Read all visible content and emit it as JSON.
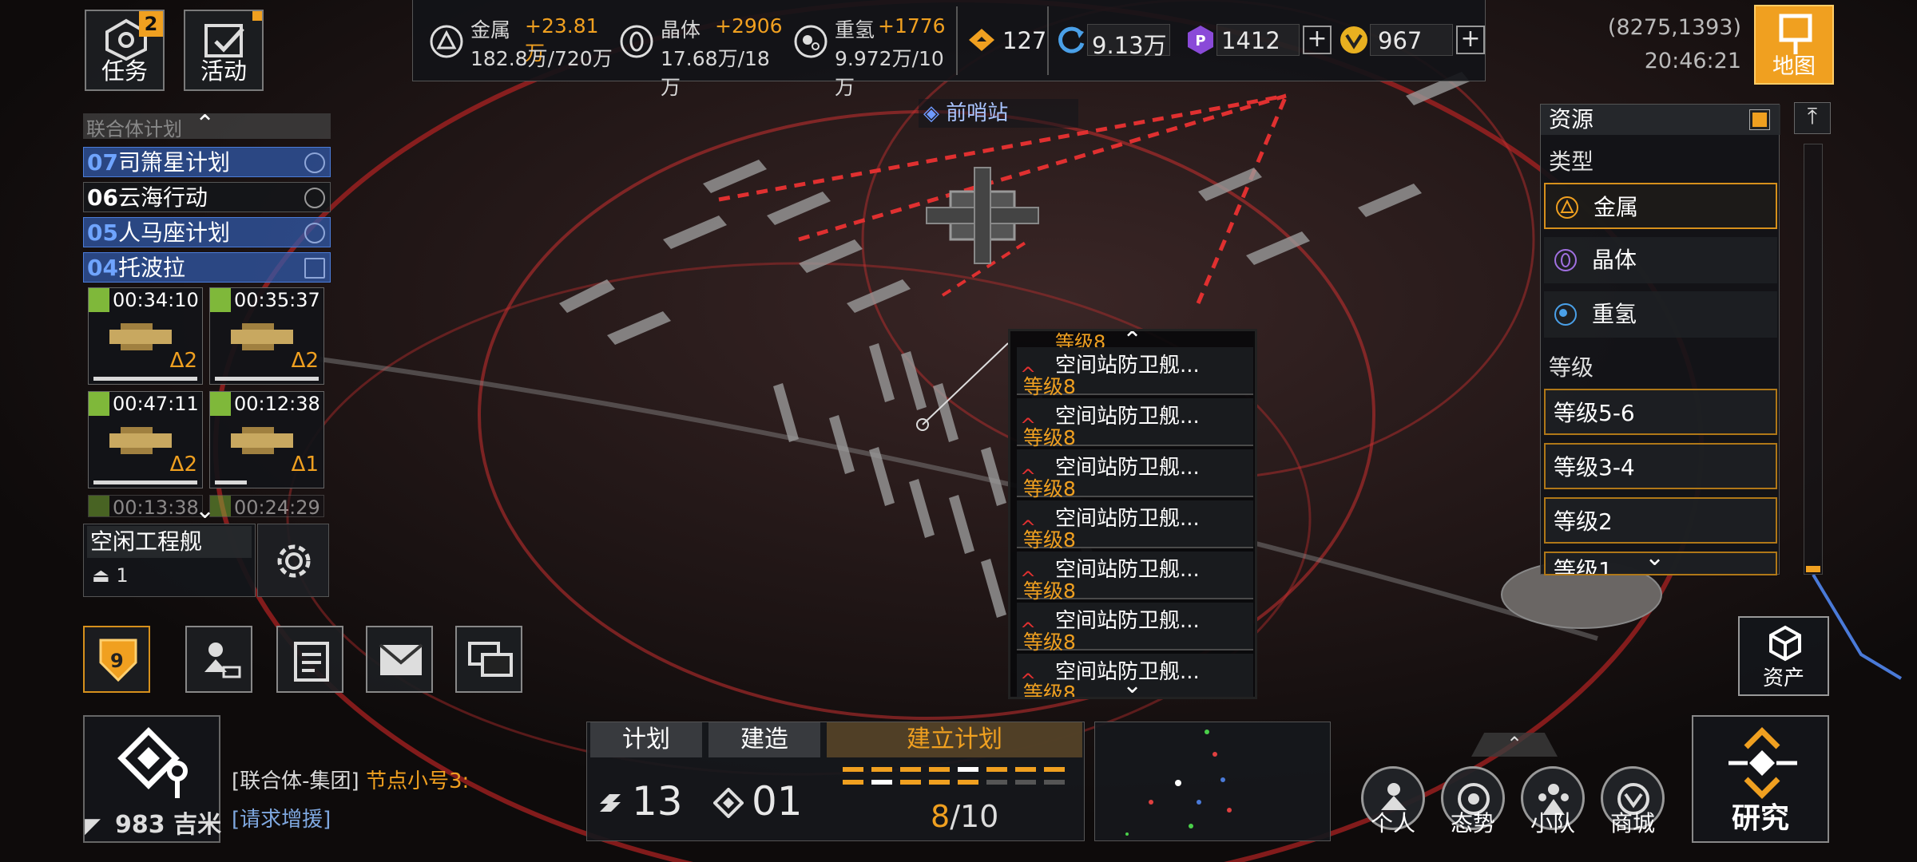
{
  "top_buttons": {
    "tasks": {
      "label": "任务",
      "badge": "2"
    },
    "activity": {
      "label": "活动"
    }
  },
  "resources": {
    "metal": {
      "name": "金属",
      "gain": "+23.81万",
      "amount": "182.8万/720万"
    },
    "crystal": {
      "name": "晶体",
      "gain": "+2906",
      "amount": "17.68万/18万"
    },
    "deuterium": {
      "name": "重氢",
      "gain": "+1776",
      "amount": "9.972万/10万"
    }
  },
  "currencies": {
    "command": "127",
    "cycle": "9.13万",
    "purple": "1412",
    "gold": "967",
    "plus": "+"
  },
  "coords": {
    "position": "(8275,1393)",
    "time": "20:46:21"
  },
  "map_button": {
    "label": "地图"
  },
  "outpost_label": "前哨站",
  "missions": {
    "header": "联合体计划",
    "items": [
      {
        "num": "07",
        "name": "司箫星计划"
      },
      {
        "num": "06",
        "name": "云海行动"
      },
      {
        "num": "05",
        "name": "人马座计划"
      },
      {
        "num": "04",
        "name": "托波拉"
      }
    ]
  },
  "timers": [
    {
      "time": "00:34:10",
      "level": "Δ2"
    },
    {
      "time": "00:35:37",
      "level": "Δ2"
    },
    {
      "time": "00:47:11",
      "level": "Δ2"
    },
    {
      "time": "00:12:38",
      "level": "Δ1"
    },
    {
      "time": "00:13:38",
      "level": ""
    },
    {
      "time": "00:24:29",
      "level": ""
    }
  ],
  "idle": {
    "title": "空闲工程舰",
    "count": "1"
  },
  "level_badge": "9",
  "filter": {
    "header": "资源",
    "type_label": "类型",
    "types": [
      "金属",
      "晶体",
      "重氢"
    ],
    "level_label": "等级",
    "levels": [
      "等级5-6",
      "等级3-4",
      "等级2",
      "等级1"
    ]
  },
  "list": {
    "top_partial": "等级8",
    "rows": [
      {
        "name": "空间站防卫舰...",
        "level": "等级8"
      },
      {
        "name": "空间站防卫舰...",
        "level": "等级8"
      },
      {
        "name": "空间站防卫舰...",
        "level": "等级8"
      },
      {
        "name": "空间站防卫舰...",
        "level": "等级8"
      },
      {
        "name": "空间站防卫舰...",
        "level": "等级8"
      },
      {
        "name": "空间站防卫舰...",
        "level": "等级8"
      },
      {
        "name": "空间站防卫舰...",
        "level": "等级8"
      }
    ]
  },
  "bottom": {
    "distance": "983 吉米",
    "chat": {
      "channel": "[联合体-集团]",
      "sender": "节点小号3:",
      "message": "[请求增援]"
    },
    "tabs": {
      "plan": "计划",
      "build": "建造",
      "establish": "建立计划"
    },
    "plan_count": "13",
    "build_count": "01",
    "progress_done": "8",
    "progress_total": "/10",
    "progress_fraction": 0.8,
    "nav": [
      "个人",
      "态势",
      "小队",
      "商城"
    ],
    "research": "研究",
    "asset": "资产"
  },
  "colors": {
    "accent": "#f0a020",
    "mission_blue": "#325aaa",
    "danger_red": "#e03030"
  }
}
